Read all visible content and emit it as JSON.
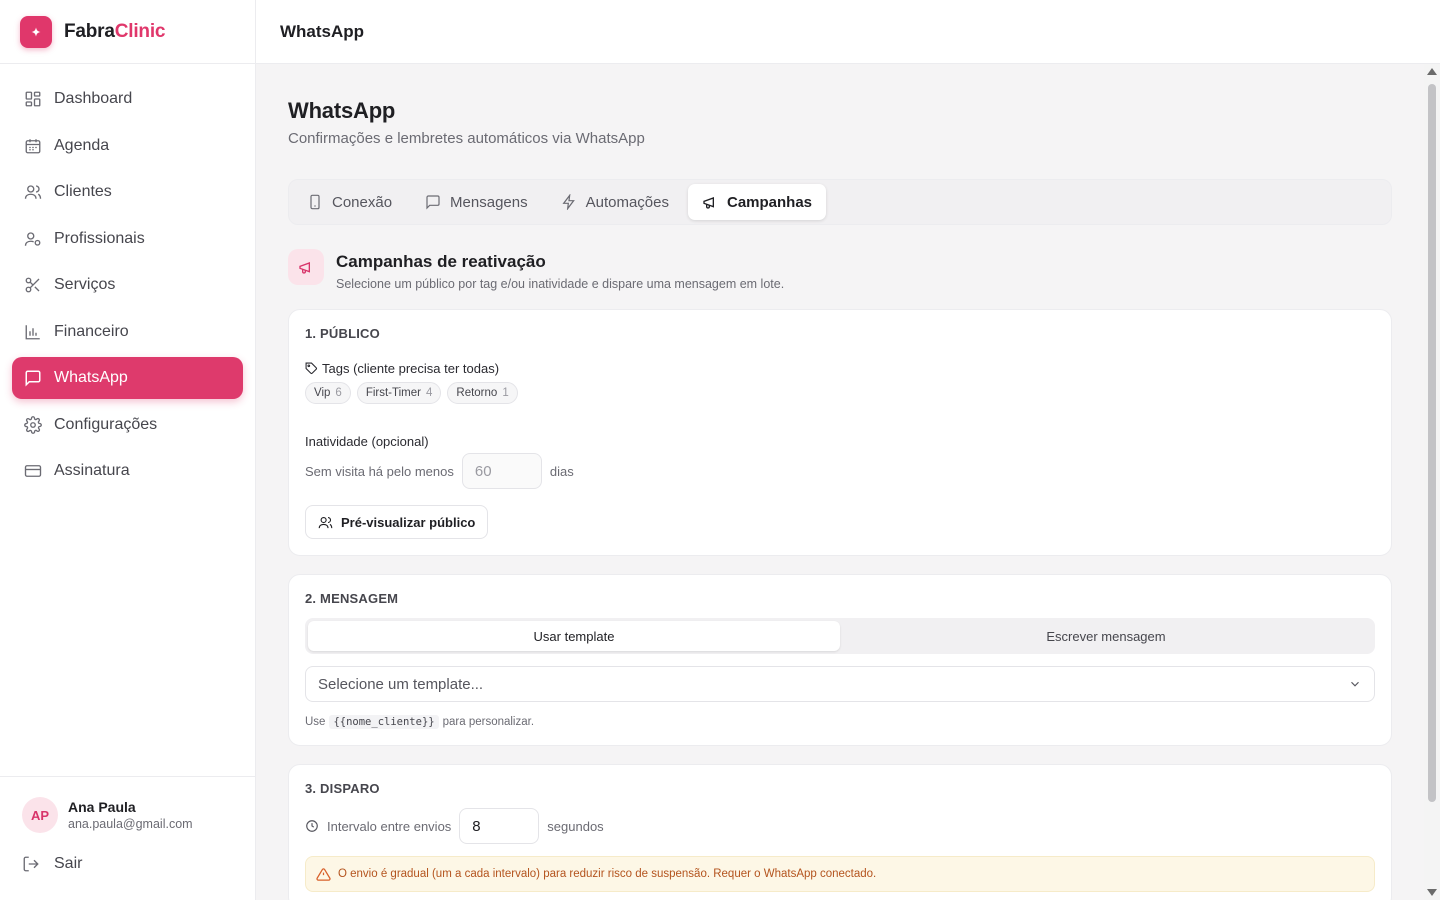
{
  "brand": {
    "name_part1": "Fabra",
    "name_part2": "Clinic",
    "accent": "#e0376b"
  },
  "sidebar": {
    "items": [
      {
        "label": "Dashboard",
        "icon": "dashboard-icon"
      },
      {
        "label": "Agenda",
        "icon": "calendar-icon"
      },
      {
        "label": "Clientes",
        "icon": "users-icon"
      },
      {
        "label": "Profissionais",
        "icon": "user-cog-icon"
      },
      {
        "label": "Serviços",
        "icon": "scissors-icon"
      },
      {
        "label": "Financeiro",
        "icon": "bar-chart-icon"
      },
      {
        "label": "WhatsApp",
        "icon": "message-icon",
        "active": true
      },
      {
        "label": "Configurações",
        "icon": "gear-icon"
      },
      {
        "label": "Assinatura",
        "icon": "credit-card-icon"
      }
    ],
    "user": {
      "initials": "AP",
      "name": "Ana Paula",
      "email": "ana.paula@gmail.com"
    },
    "logout_label": "Sair"
  },
  "topbar": {
    "title": "WhatsApp"
  },
  "page": {
    "title": "WhatsApp",
    "subtitle": "Confirmações e lembretes automáticos via WhatsApp"
  },
  "tabs": [
    {
      "label": "Conexão",
      "icon": "phone-icon"
    },
    {
      "label": "Mensagens",
      "icon": "message-icon"
    },
    {
      "label": "Automações",
      "icon": "lightning-icon"
    },
    {
      "label": "Campanhas",
      "icon": "megaphone-icon",
      "active": true
    }
  ],
  "campaign": {
    "title": "Campanhas de reativação",
    "subtitle": "Selecione um público por tag e/ou inatividade e dispare uma mensagem em lote."
  },
  "publico": {
    "label": "1. PÚBLICO",
    "tags_label": "Tags (cliente precisa ter todas)",
    "tags": [
      {
        "name": "Vip",
        "count": "6"
      },
      {
        "name": "First-Timer",
        "count": "4"
      },
      {
        "name": "Retorno",
        "count": "1"
      }
    ],
    "inactivity_label": "Inatividade (opcional)",
    "inactivity_prefix": "Sem visita há pelo menos",
    "inactivity_value": "60",
    "inactivity_unit": "dias",
    "preview_button": "Pré-visualizar público"
  },
  "mensagem": {
    "label": "2. MENSAGEM",
    "seg_template": "Usar template",
    "seg_write": "Escrever mensagem",
    "select_placeholder": "Selecione um template...",
    "hint_prefix": "Use",
    "hint_code": "{{nome_cliente}}",
    "hint_suffix": "para personalizar."
  },
  "disparo": {
    "label": "3. DISPARO",
    "interval_label": "Intervalo entre envios",
    "interval_value": "8",
    "interval_unit": "segundos",
    "warning": "O envio é gradual (um a cada intervalo) para reduzir risco de suspensão. Requer o WhatsApp conectado."
  }
}
